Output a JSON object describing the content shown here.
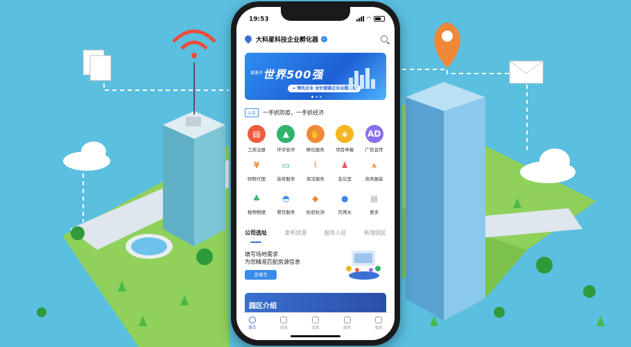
{
  "status": {
    "time": "19:53"
  },
  "header": {
    "title": "大科星科技企业孵化器",
    "verified_mark": "✓"
  },
  "banner": {
    "small": "滴滴子",
    "big": "世界500强",
    "tag": "→ 领先企业  全价值链企业云服务商"
  },
  "notice": {
    "badge": "公告",
    "text": "一手抓防疫，一手抓经济"
  },
  "services": [
    {
      "label": "工商注册",
      "icon": "document-icon",
      "color": "#ef5b3f",
      "glyph": "▤"
    },
    {
      "label": "环评安评",
      "icon": "tree-icon",
      "color": "#2fb36b",
      "glyph": "▲"
    },
    {
      "label": "孵化服务",
      "icon": "hand-icon",
      "color": "#f08a3a",
      "glyph": "✋"
    },
    {
      "label": "项目申报",
      "icon": "layers-icon",
      "color": "#f3b61f",
      "glyph": "◈"
    },
    {
      "label": "广告宣传",
      "icon": "ad-icon",
      "color": "#8a6ff0",
      "glyph": "AD"
    },
    {
      "label": "财税代理",
      "icon": "coin-icon",
      "color": "#f08a3a",
      "glyph": "¥"
    },
    {
      "label": "装修服务",
      "icon": "paint-roller-icon",
      "color": "#2fb36b",
      "glyph": "▭"
    },
    {
      "label": "保洁服务",
      "icon": "broom-icon",
      "color": "#f3a21f",
      "glyph": "⌇"
    },
    {
      "label": "会议室",
      "icon": "meeting-icon",
      "color": "#ef4f6a",
      "glyph": "♟"
    },
    {
      "label": "商务报装",
      "icon": "suit-icon",
      "color": "#f08a3a",
      "glyph": "⩚"
    },
    {
      "label": "植物租摆",
      "icon": "plant-icon",
      "color": "#2fb36b",
      "glyph": "♣"
    },
    {
      "label": "餐饮服务",
      "icon": "dish-icon",
      "color": "#3b8ce8",
      "glyph": "◓"
    },
    {
      "label": "检验检测",
      "icon": "shield-icon",
      "color": "#f08a3a",
      "glyph": "◆"
    },
    {
      "label": "饮用水",
      "icon": "water-drop-icon",
      "color": "#3b8ce8",
      "glyph": "●"
    },
    {
      "label": "更多",
      "icon": "more-grid-icon",
      "color": "#bbbbbb",
      "glyph": "▦"
    }
  ],
  "tabs": [
    "公司选址",
    "发布房源",
    "服务入驻",
    "新增园区"
  ],
  "card": {
    "line1": "填写场地需求",
    "line2": "为您精准匹配房源信息",
    "button": "去填写"
  },
  "park": {
    "title": "园区介绍"
  },
  "tabbar": [
    "首页",
    "招商",
    "消息",
    "服务",
    "我的"
  ]
}
